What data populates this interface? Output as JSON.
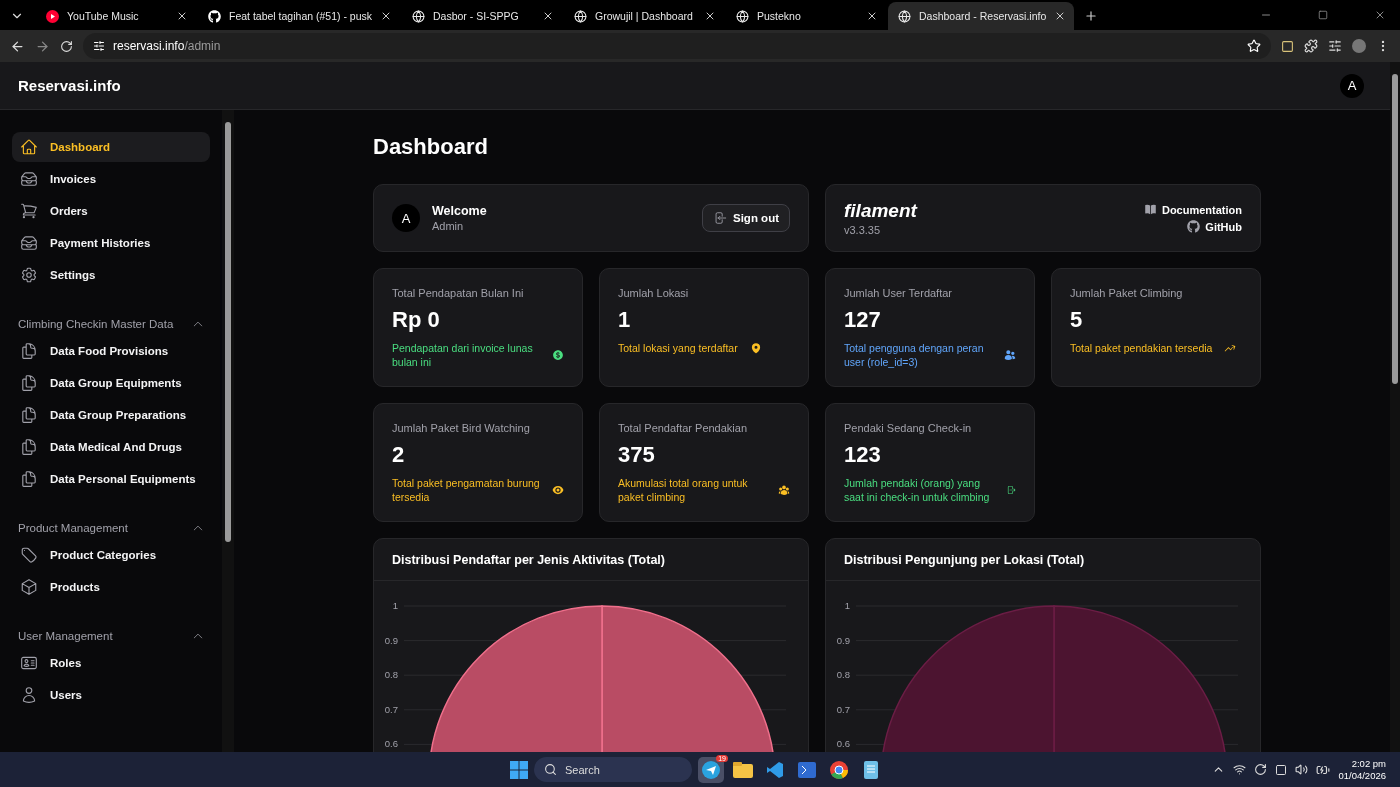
{
  "browser": {
    "tabs": [
      {
        "title": "YouTube Music",
        "kind": "youtube",
        "selected": false
      },
      {
        "title": "Feat tabel tagihan (#51) - pusk",
        "kind": "github",
        "selected": false
      },
      {
        "title": "Dasbor - SI-SPPG",
        "kind": "globe",
        "selected": false
      },
      {
        "title": "Growujil | Dashboard",
        "kind": "globe",
        "selected": false
      },
      {
        "title": "Pustekno",
        "kind": "globe",
        "selected": false
      },
      {
        "title": "Dashboard - Reservasi.info",
        "kind": "globe",
        "selected": true
      }
    ],
    "url_host": "reservasi.info",
    "url_path": "/admin"
  },
  "topbar": {
    "brand": "Reservasi.info",
    "avatar": "A"
  },
  "sidebar": {
    "groups": [
      {
        "items": [
          {
            "label": "Dashboard",
            "selected": true
          },
          {
            "label": "Invoices",
            "selected": false
          },
          {
            "label": "Orders",
            "selected": false
          },
          {
            "label": "Payment Histories",
            "selected": false
          },
          {
            "label": "Settings",
            "selected": false
          }
        ]
      },
      {
        "label": "Climbing Checkin Master Data",
        "expanded": true,
        "items": [
          {
            "label": "Data Food Provisions",
            "selected": false
          },
          {
            "label": "Data Group Equipments",
            "selected": false
          },
          {
            "label": "Data Group Preparations",
            "selected": false
          },
          {
            "label": "Data Medical And Drugs",
            "selected": false
          },
          {
            "label": "Data Personal Equipments",
            "selected": false
          }
        ]
      },
      {
        "label": "Product Management",
        "expanded": true,
        "items": [
          {
            "label": "Product Categories",
            "selected": false
          },
          {
            "label": "Products",
            "selected": false
          }
        ]
      },
      {
        "label": "User Management",
        "expanded": true,
        "items": [
          {
            "label": "Roles",
            "selected": false
          },
          {
            "label": "Users",
            "selected": false
          }
        ]
      }
    ]
  },
  "page": {
    "title": "Dashboard",
    "welcome": {
      "avatar": "A",
      "title": "Welcome",
      "name": "Admin",
      "button": "Sign out"
    },
    "filament": {
      "logo": "filament",
      "version": "v3.3.35",
      "links": [
        "Documentation",
        "GitHub"
      ]
    },
    "stats": [
      {
        "label": "Total Pendapatan Bulan Ini",
        "value": "Rp 0",
        "description": "Pendapatan dari invoice lunas bulan ini",
        "color": "#4ade80"
      },
      {
        "label": "Jumlah Lokasi",
        "value": "1",
        "description": "Total lokasi yang terdaftar",
        "color": "#fbbf24"
      },
      {
        "label": "Jumlah User Terdaftar",
        "value": "127",
        "description": "Total pengguna dengan peran user (role_id=3)",
        "color": "#60a5fa"
      },
      {
        "label": "Jumlah Paket Climbing",
        "value": "5",
        "description": "Total paket pendakian tersedia",
        "color": "#fbbf24"
      },
      {
        "label": "Jumlah Paket Bird Watching",
        "value": "2",
        "description": "Total paket pengamatan burung tersedia",
        "color": "#fbbf24"
      },
      {
        "label": "Total Pendaftar Pendakian",
        "value": "375",
        "description": "Akumulasi total orang untuk paket climbing",
        "color": "#fbbf24"
      },
      {
        "label": "Pendaki Sedang Check-in",
        "value": "123",
        "description": "Jumlah pendaki (orang) yang saat ini check-in untuk climbing",
        "color": "#4ade80"
      }
    ],
    "charts": [
      {
        "heading": "Distribusi Pendaftar per Jenis Aktivitas (Total)",
        "axis_labels": [
          "1",
          "0.9",
          "0.8",
          "0.7",
          "0.6"
        ]
      },
      {
        "heading": "Distribusi Pengunjung per Lokasi (Total)",
        "axis_labels": [
          "1",
          "0.9",
          "0.8",
          "0.7",
          "0.6"
        ]
      }
    ]
  },
  "taskbar": {
    "search": "Search",
    "badge": "19",
    "time": "2:02 pm",
    "date": "01/04/2026"
  }
}
